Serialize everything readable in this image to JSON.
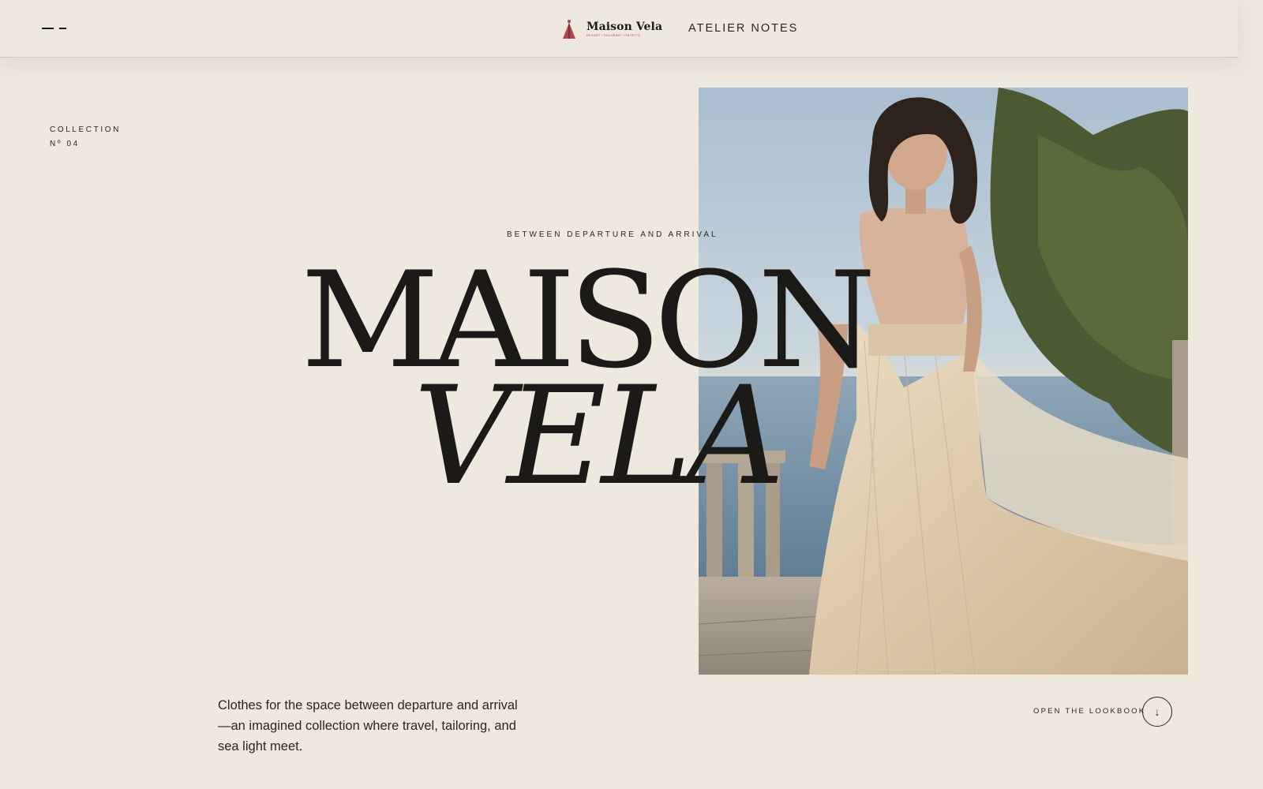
{
  "header": {
    "brand_name": "Maison Vela",
    "brand_tagline": "RESORT / TAILORING / OBJECTS",
    "nav_link": "ATELIER NOTES"
  },
  "collection": {
    "line1": "COLLECTION",
    "line2": "Nº 04"
  },
  "hero": {
    "eyebrow": "BETWEEN DEPARTURE AND ARRIVAL",
    "title_line1": "MAISON",
    "title_line2": "VELA",
    "intro": "Clothes for the space between departure and arrival—an imagined collection where travel, tailoring, and sea light meet.",
    "image_subject": "model in flowing cream dress on seaside terrace"
  },
  "cta": {
    "label": "OPEN THE LOOKBOOK",
    "icon": "↓"
  },
  "colors": {
    "background": "#efe8df",
    "ink": "#1c1a17",
    "brand_accent": "#b2434f"
  }
}
